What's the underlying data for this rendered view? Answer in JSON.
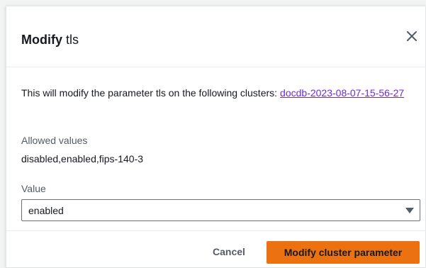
{
  "modal": {
    "title_strong": "Modify",
    "title_param": "tls",
    "close_icon": "close-icon"
  },
  "body": {
    "description": "This will modify the parameter tls on the following clusters:",
    "cluster_link": "docdb-2023-08-07-15-56-27",
    "allowed_label": "Allowed values",
    "allowed_values": "disabled,enabled,fips-140-3",
    "value_label": "Value",
    "select_value": "enabled",
    "select_icon": "caret-down-icon"
  },
  "footer": {
    "cancel_label": "Cancel",
    "submit_label": "Modify cluster parameter"
  },
  "colors": {
    "primary": "#ec7211",
    "link": "#6c2bd9",
    "text": "#16191f",
    "muted": "#545b64"
  }
}
